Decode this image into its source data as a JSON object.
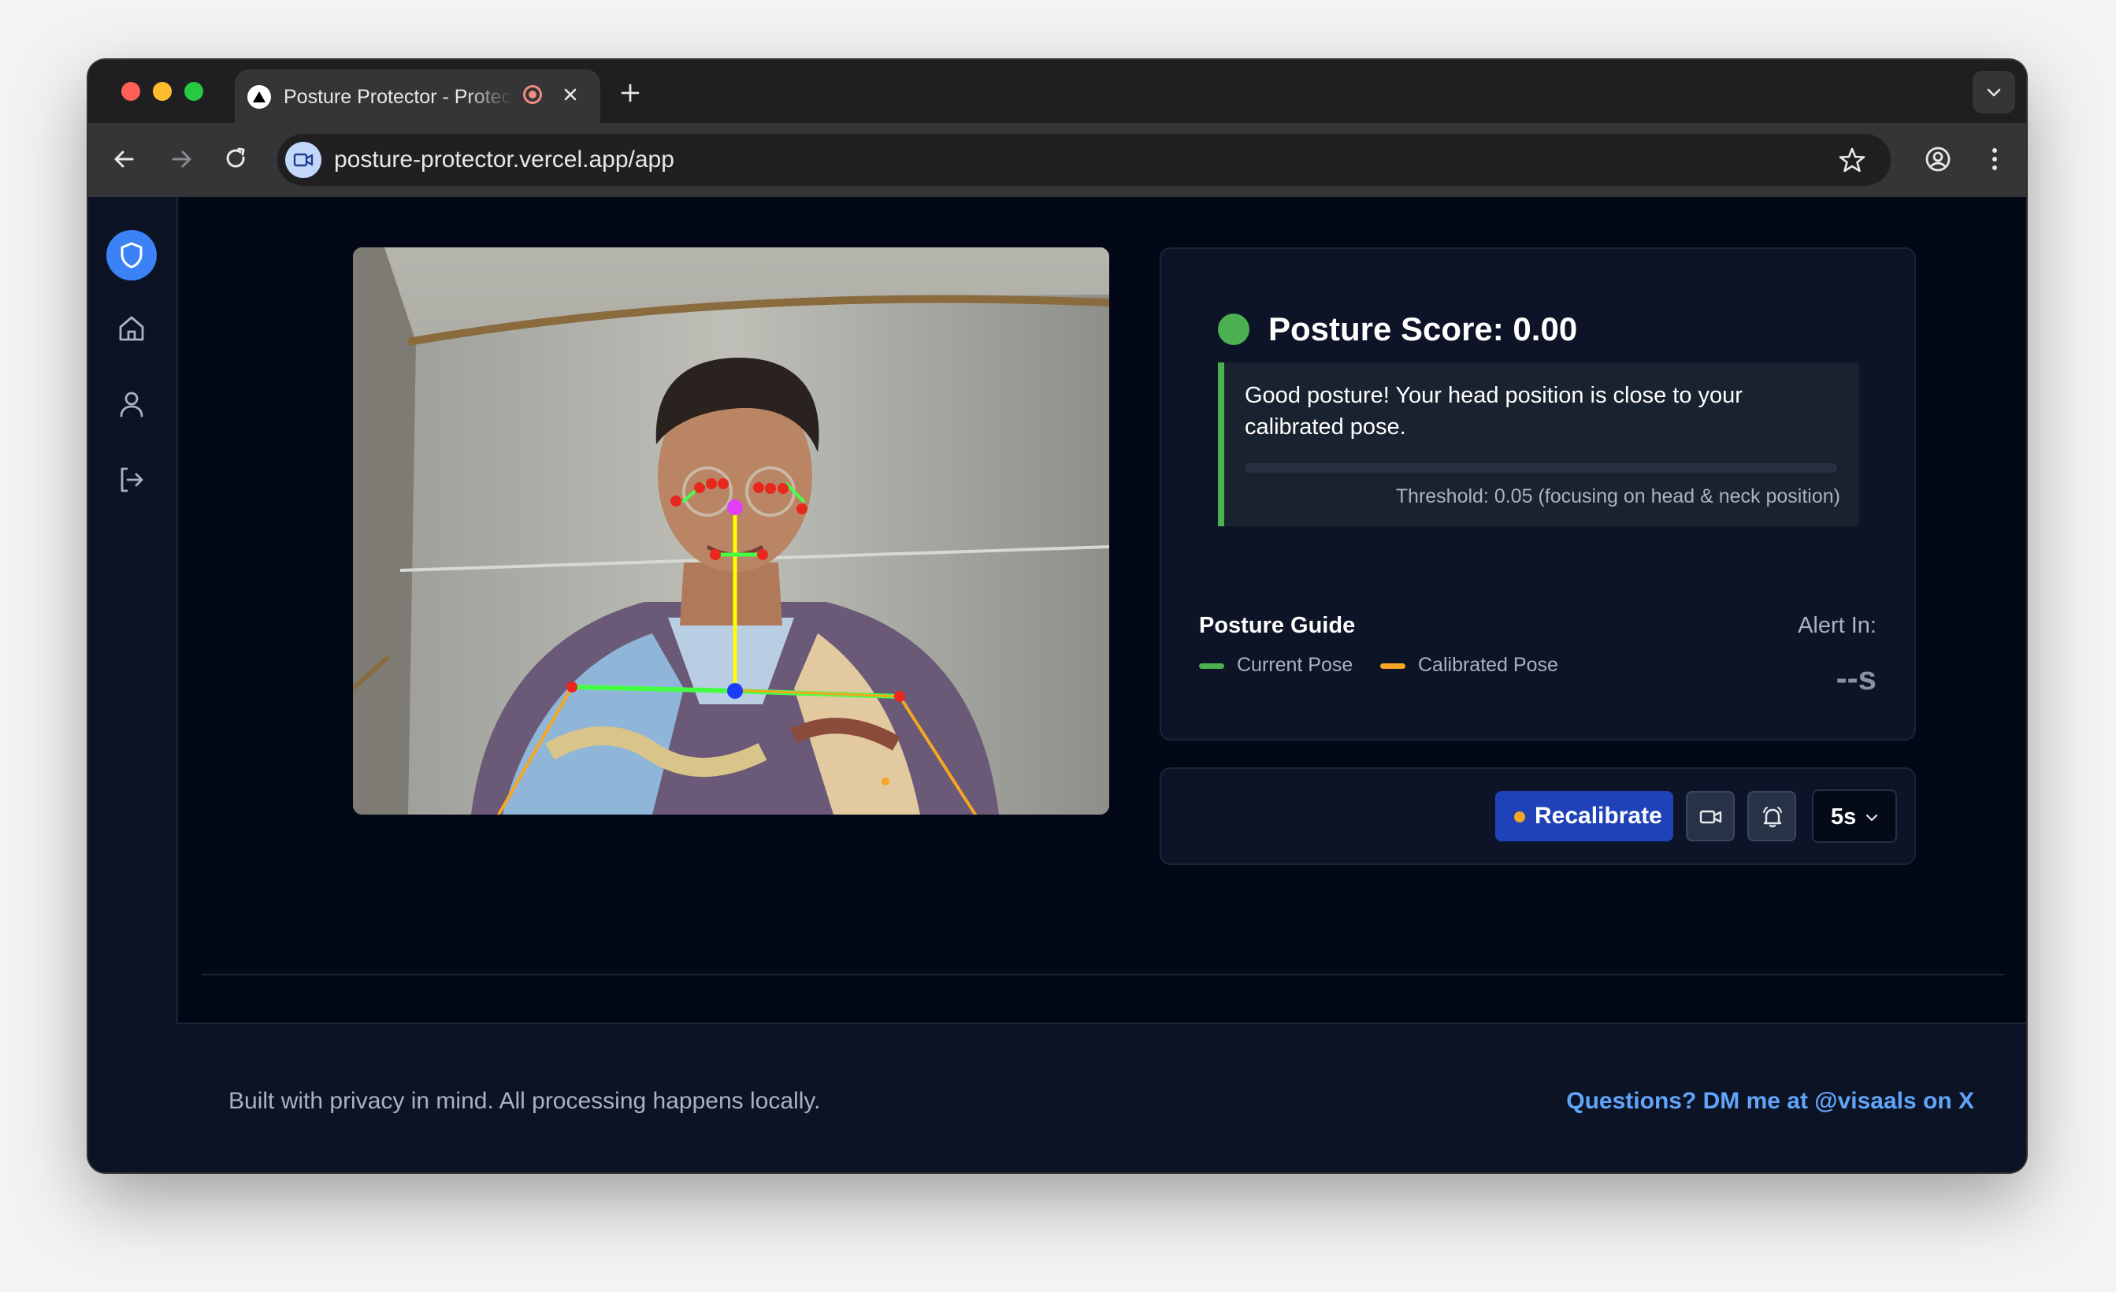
{
  "browser": {
    "tab_title": "Posture Protector - Protect",
    "url": "posture-protector.vercel.app/app"
  },
  "score": {
    "title": "Posture Score: 0.00",
    "status_color": "#4caf50",
    "message": "Good posture! Your head position is close to your calibrated pose.",
    "threshold": "Threshold: 0.05 (focusing on head & neck position)"
  },
  "guide": {
    "title": "Posture Guide",
    "current_label": "Current Pose",
    "current_color": "#4caf50",
    "calibrated_label": "Calibrated Pose",
    "calibrated_color": "#f5a623",
    "alert_label": "Alert In:",
    "alert_value": "--s"
  },
  "controls": {
    "recalibrate_label": "Recalibrate",
    "interval_value": "5s"
  },
  "footer": {
    "left": "Built with privacy in mind. All processing happens locally.",
    "right": "Questions? DM me at @visaals on X"
  },
  "icons": [
    "shield-icon",
    "home-icon",
    "user-icon",
    "logout-icon",
    "camera-icon",
    "bell-icon",
    "star-icon",
    "chevron-down-icon"
  ]
}
